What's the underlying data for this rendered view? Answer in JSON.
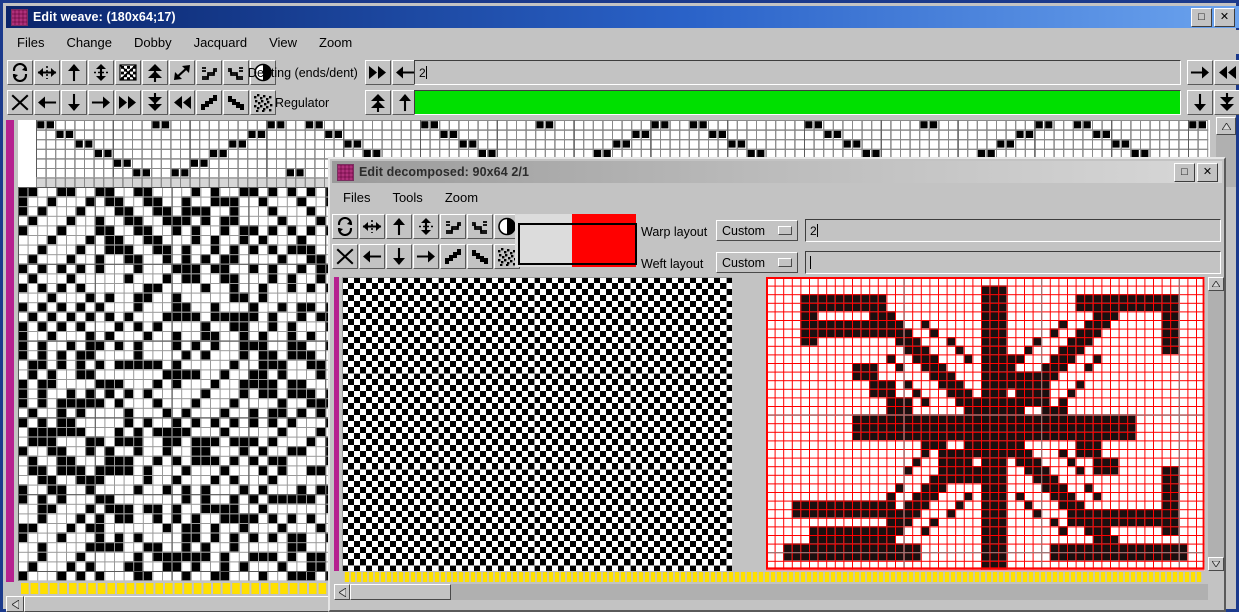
{
  "main_window": {
    "title": "Edit weave:  (180x64;17)",
    "title_icon": "weave-swatch-icon",
    "window_buttons": [
      {
        "name": "maximize",
        "glyph": "□"
      },
      {
        "name": "close",
        "glyph": "✕"
      }
    ],
    "menus": [
      "Files",
      "Change",
      "Dobby",
      "Jacquard",
      "View",
      "Zoom"
    ],
    "toolbar_row1": [
      {
        "name": "flip-rotate-icon",
        "glyph": "rotate"
      },
      {
        "name": "flip-horizontal-icon",
        "glyph": "harrows"
      },
      {
        "name": "move-up-icon",
        "glyph": "up"
      },
      {
        "name": "move-vertical-icon",
        "glyph": "updown"
      },
      {
        "name": "invert-pattern-icon",
        "glyph": "hatchbox"
      },
      {
        "name": "merge-up-icon",
        "glyph": "dblup"
      },
      {
        "name": "expand-diagonal-icon",
        "glyph": "diag"
      },
      {
        "name": "shift-steps-icon",
        "glyph": "steps1"
      },
      {
        "name": "shift-steps-alt-icon",
        "glyph": "steps2"
      },
      {
        "name": "contrast-icon",
        "glyph": "halfcircle"
      }
    ],
    "toolbar_row2": [
      {
        "name": "clear-icon",
        "glyph": "x"
      },
      {
        "name": "move-left-icon",
        "glyph": "left"
      },
      {
        "name": "move-down-icon",
        "glyph": "down"
      },
      {
        "name": "move-right-icon",
        "glyph": "right"
      },
      {
        "name": "jump-left-icon",
        "glyph": "dblleft"
      },
      {
        "name": "merge-down-icon",
        "glyph": "dbldown"
      },
      {
        "name": "jump-right-icon",
        "glyph": "dblright"
      },
      {
        "name": "stagger-up-icon",
        "glyph": "stag1"
      },
      {
        "name": "stagger-down-icon",
        "glyph": "stag2"
      },
      {
        "name": "noise-fill-icon",
        "glyph": "noise"
      }
    ],
    "denting": {
      "label": "Denting (ends/dent)",
      "value": "2",
      "left_buttons": [
        {
          "name": "denting-page-left",
          "glyph": "dblleft"
        },
        {
          "name": "denting-step-left",
          "glyph": "left"
        }
      ],
      "right_buttons": [
        {
          "name": "denting-step-right",
          "glyph": "right"
        },
        {
          "name": "denting-page-right",
          "glyph": "dblright"
        }
      ]
    },
    "regulator": {
      "label": "Regulator",
      "bar_color": "#00e000",
      "left_buttons": [
        {
          "name": "regulator-page-up",
          "glyph": "dblup"
        },
        {
          "name": "regulator-step-up",
          "glyph": "up"
        }
      ],
      "right_buttons": [
        {
          "name": "regulator-step-down",
          "glyph": "down"
        },
        {
          "name": "regulator-page-down",
          "glyph": "dbldown"
        }
      ]
    },
    "scrollbars": {
      "vertical_name": "main-vertical-scrollbar",
      "horizontal_name": "main-horizontal-scrollbar"
    }
  },
  "dialog": {
    "title": "Edit decomposed:  90x64 2/1",
    "title_icon": "weave-swatch-icon",
    "window_buttons": [
      {
        "name": "maximize",
        "glyph": "□"
      },
      {
        "name": "close",
        "glyph": "✕"
      }
    ],
    "menus": [
      "Files",
      "Tools",
      "Zoom"
    ],
    "toolbar_row1": [
      {
        "name": "flip-rotate-icon",
        "glyph": "rotate"
      },
      {
        "name": "flip-horizontal-icon",
        "glyph": "harrows"
      },
      {
        "name": "move-up-icon",
        "glyph": "up"
      },
      {
        "name": "move-vertical-icon",
        "glyph": "updown"
      },
      {
        "name": "shift-steps-icon",
        "glyph": "steps1"
      },
      {
        "name": "shift-steps-alt-icon",
        "glyph": "steps2"
      },
      {
        "name": "contrast-icon",
        "glyph": "halfcircle"
      }
    ],
    "toolbar_row2": [
      {
        "name": "clear-icon",
        "glyph": "x"
      },
      {
        "name": "move-left-icon",
        "glyph": "left"
      },
      {
        "name": "move-down-icon",
        "glyph": "down"
      },
      {
        "name": "move-right-icon",
        "glyph": "right"
      },
      {
        "name": "stagger-up-icon",
        "glyph": "stag1"
      },
      {
        "name": "stagger-down-icon",
        "glyph": "stag2"
      },
      {
        "name": "noise-fill-icon",
        "glyph": "noise"
      }
    ],
    "color_swatches": [
      {
        "name": "warp-color-swatch",
        "color": "#dcdcdc"
      },
      {
        "name": "weft-color-swatch",
        "color": "#ff0000"
      }
    ],
    "warp_layout": {
      "label": "Warp layout",
      "value": "Custom",
      "repeat": "2"
    },
    "weft_layout": {
      "label": "Weft layout",
      "value": "Custom",
      "repeat": ""
    },
    "scrollbars": {
      "horizontal_name": "dialog-horizontal-scrollbar",
      "vertical_name": "dialog-vertical-scrollbar"
    }
  },
  "drafts": {
    "main_weave": {
      "name": "main-weave-grid",
      "grid_color": "#808080",
      "set_color": "#000000",
      "unset_color": "#ffffff",
      "selvedge_color": "#b5218f",
      "tieup_color": "#ffe000"
    },
    "decomposed_left": {
      "name": "decomposed-plainweave-grid",
      "description": "fine black/white checkerboard (plain weave)",
      "set_color": "#000000",
      "unset_color": "#ffffff",
      "grid_color": "#9a9a9a"
    },
    "decomposed_right": {
      "name": "decomposed-pattern-grid",
      "description": "snowflake/star motif on red gridlines",
      "grid_color": "#ff0000",
      "set_color": "#1a0f0f",
      "unset_color": "#ffffff"
    }
  }
}
